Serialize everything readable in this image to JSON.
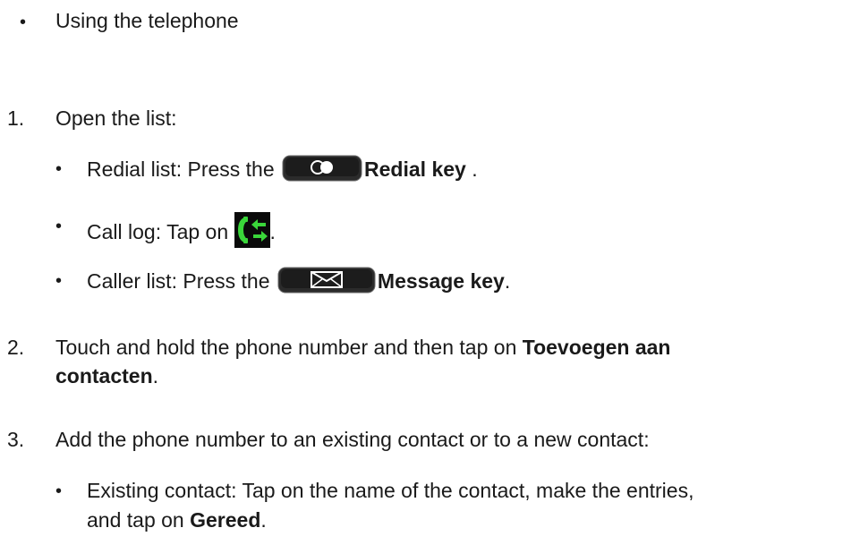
{
  "intro": {
    "bullet": "•",
    "text": "Using the telephone"
  },
  "steps": [
    {
      "number": "1.",
      "text": "Open the list:"
    },
    {
      "number": "2.",
      "text_before": "Touch and hold the phone number and then tap on ",
      "bold1": "Toevoegen aan",
      "bold2": "contacten",
      "text_after": "."
    },
    {
      "number": "3.",
      "text": "Add the phone number to an existing contact or to a new contact:"
    }
  ],
  "sub_items": {
    "redial": {
      "text_before": "Redial list: Press the ",
      "key_label": "Redial key",
      "text_after": " .",
      "icon": "redial-key-icon"
    },
    "calllog": {
      "text_before": "Call log: Tap on ",
      "text_after": ".",
      "icon": "call-log-icon"
    },
    "caller": {
      "text_before": "Caller list: Press the ",
      "key_label": "Message key",
      "text_after": ".",
      "icon": "message-key-icon"
    },
    "existing": {
      "line1": "Existing contact: Tap on the name of the contact, make the entries,",
      "text_before": "and tap on ",
      "bold": "Gereed",
      "text_after": "."
    }
  },
  "colors": {
    "text": "#1a1a1a",
    "key_body": "#1c1c1c",
    "calllog_bg": "#0a0a0a",
    "calllog_arrow": "#3ad63a"
  }
}
